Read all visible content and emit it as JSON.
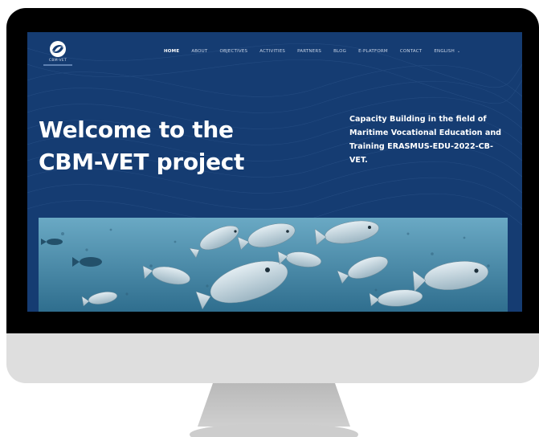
{
  "site": {
    "logo_text": "CBM-VET"
  },
  "nav": {
    "items": [
      {
        "label": "HOME",
        "active": true
      },
      {
        "label": "ABOUT"
      },
      {
        "label": "OBJECTIVES"
      },
      {
        "label": "ACTIVITIES"
      },
      {
        "label": "PARTNERS"
      },
      {
        "label": "BLOG"
      },
      {
        "label": "E-PLATFORM"
      },
      {
        "label": "CONTACT"
      },
      {
        "label": "ENGLISH"
      }
    ]
  },
  "hero": {
    "title_line1": "Welcome to the",
    "title_line2": "CBM-VET project",
    "description": "Capacity Building in the field of Maritime Vocational Education and Training ERASMUS-EDU-2022-CB-VET."
  },
  "colors": {
    "screen_bg": "#153c72",
    "text": "#ffffff",
    "nav_text": "#c7d3e6",
    "water": "#3f86a6"
  },
  "icons": {
    "logo": "swirl-logo-icon",
    "language_dropdown": "chevron-down-icon"
  }
}
